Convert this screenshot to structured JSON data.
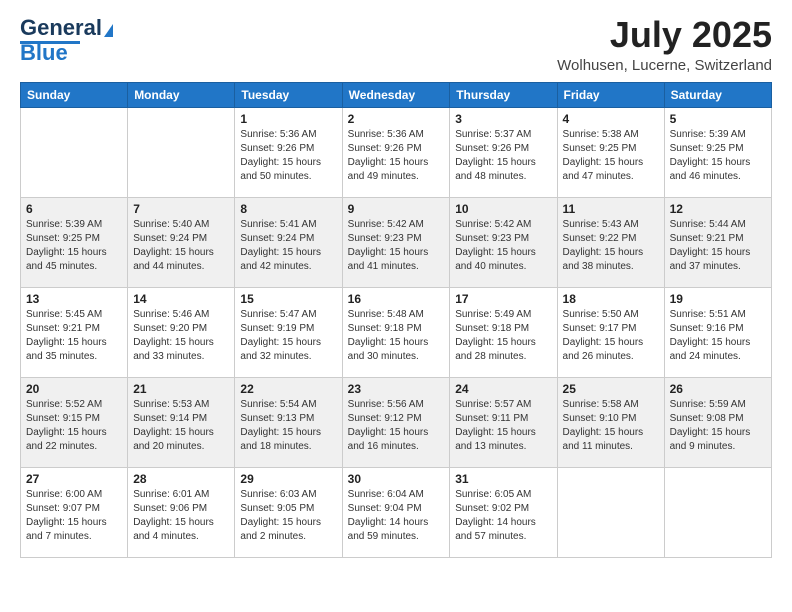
{
  "header": {
    "logo_general": "General",
    "logo_blue": "Blue",
    "main_title": "July 2025",
    "subtitle": "Wolhusen, Lucerne, Switzerland"
  },
  "calendar": {
    "days_of_week": [
      "Sunday",
      "Monday",
      "Tuesday",
      "Wednesday",
      "Thursday",
      "Friday",
      "Saturday"
    ],
    "weeks": [
      [
        {
          "day": "",
          "info": ""
        },
        {
          "day": "",
          "info": ""
        },
        {
          "day": "1",
          "info": "Sunrise: 5:36 AM\nSunset: 9:26 PM\nDaylight: 15 hours\nand 50 minutes."
        },
        {
          "day": "2",
          "info": "Sunrise: 5:36 AM\nSunset: 9:26 PM\nDaylight: 15 hours\nand 49 minutes."
        },
        {
          "day": "3",
          "info": "Sunrise: 5:37 AM\nSunset: 9:26 PM\nDaylight: 15 hours\nand 48 minutes."
        },
        {
          "day": "4",
          "info": "Sunrise: 5:38 AM\nSunset: 9:25 PM\nDaylight: 15 hours\nand 47 minutes."
        },
        {
          "day": "5",
          "info": "Sunrise: 5:39 AM\nSunset: 9:25 PM\nDaylight: 15 hours\nand 46 minutes."
        }
      ],
      [
        {
          "day": "6",
          "info": "Sunrise: 5:39 AM\nSunset: 9:25 PM\nDaylight: 15 hours\nand 45 minutes."
        },
        {
          "day": "7",
          "info": "Sunrise: 5:40 AM\nSunset: 9:24 PM\nDaylight: 15 hours\nand 44 minutes."
        },
        {
          "day": "8",
          "info": "Sunrise: 5:41 AM\nSunset: 9:24 PM\nDaylight: 15 hours\nand 42 minutes."
        },
        {
          "day": "9",
          "info": "Sunrise: 5:42 AM\nSunset: 9:23 PM\nDaylight: 15 hours\nand 41 minutes."
        },
        {
          "day": "10",
          "info": "Sunrise: 5:42 AM\nSunset: 9:23 PM\nDaylight: 15 hours\nand 40 minutes."
        },
        {
          "day": "11",
          "info": "Sunrise: 5:43 AM\nSunset: 9:22 PM\nDaylight: 15 hours\nand 38 minutes."
        },
        {
          "day": "12",
          "info": "Sunrise: 5:44 AM\nSunset: 9:21 PM\nDaylight: 15 hours\nand 37 minutes."
        }
      ],
      [
        {
          "day": "13",
          "info": "Sunrise: 5:45 AM\nSunset: 9:21 PM\nDaylight: 15 hours\nand 35 minutes."
        },
        {
          "day": "14",
          "info": "Sunrise: 5:46 AM\nSunset: 9:20 PM\nDaylight: 15 hours\nand 33 minutes."
        },
        {
          "day": "15",
          "info": "Sunrise: 5:47 AM\nSunset: 9:19 PM\nDaylight: 15 hours\nand 32 minutes."
        },
        {
          "day": "16",
          "info": "Sunrise: 5:48 AM\nSunset: 9:18 PM\nDaylight: 15 hours\nand 30 minutes."
        },
        {
          "day": "17",
          "info": "Sunrise: 5:49 AM\nSunset: 9:18 PM\nDaylight: 15 hours\nand 28 minutes."
        },
        {
          "day": "18",
          "info": "Sunrise: 5:50 AM\nSunset: 9:17 PM\nDaylight: 15 hours\nand 26 minutes."
        },
        {
          "day": "19",
          "info": "Sunrise: 5:51 AM\nSunset: 9:16 PM\nDaylight: 15 hours\nand 24 minutes."
        }
      ],
      [
        {
          "day": "20",
          "info": "Sunrise: 5:52 AM\nSunset: 9:15 PM\nDaylight: 15 hours\nand 22 minutes."
        },
        {
          "day": "21",
          "info": "Sunrise: 5:53 AM\nSunset: 9:14 PM\nDaylight: 15 hours\nand 20 minutes."
        },
        {
          "day": "22",
          "info": "Sunrise: 5:54 AM\nSunset: 9:13 PM\nDaylight: 15 hours\nand 18 minutes."
        },
        {
          "day": "23",
          "info": "Sunrise: 5:56 AM\nSunset: 9:12 PM\nDaylight: 15 hours\nand 16 minutes."
        },
        {
          "day": "24",
          "info": "Sunrise: 5:57 AM\nSunset: 9:11 PM\nDaylight: 15 hours\nand 13 minutes."
        },
        {
          "day": "25",
          "info": "Sunrise: 5:58 AM\nSunset: 9:10 PM\nDaylight: 15 hours\nand 11 minutes."
        },
        {
          "day": "26",
          "info": "Sunrise: 5:59 AM\nSunset: 9:08 PM\nDaylight: 15 hours\nand 9 minutes."
        }
      ],
      [
        {
          "day": "27",
          "info": "Sunrise: 6:00 AM\nSunset: 9:07 PM\nDaylight: 15 hours\nand 7 minutes."
        },
        {
          "day": "28",
          "info": "Sunrise: 6:01 AM\nSunset: 9:06 PM\nDaylight: 15 hours\nand 4 minutes."
        },
        {
          "day": "29",
          "info": "Sunrise: 6:03 AM\nSunset: 9:05 PM\nDaylight: 15 hours\nand 2 minutes."
        },
        {
          "day": "30",
          "info": "Sunrise: 6:04 AM\nSunset: 9:04 PM\nDaylight: 14 hours\nand 59 minutes."
        },
        {
          "day": "31",
          "info": "Sunrise: 6:05 AM\nSunset: 9:02 PM\nDaylight: 14 hours\nand 57 minutes."
        },
        {
          "day": "",
          "info": ""
        },
        {
          "day": "",
          "info": ""
        }
      ]
    ]
  }
}
